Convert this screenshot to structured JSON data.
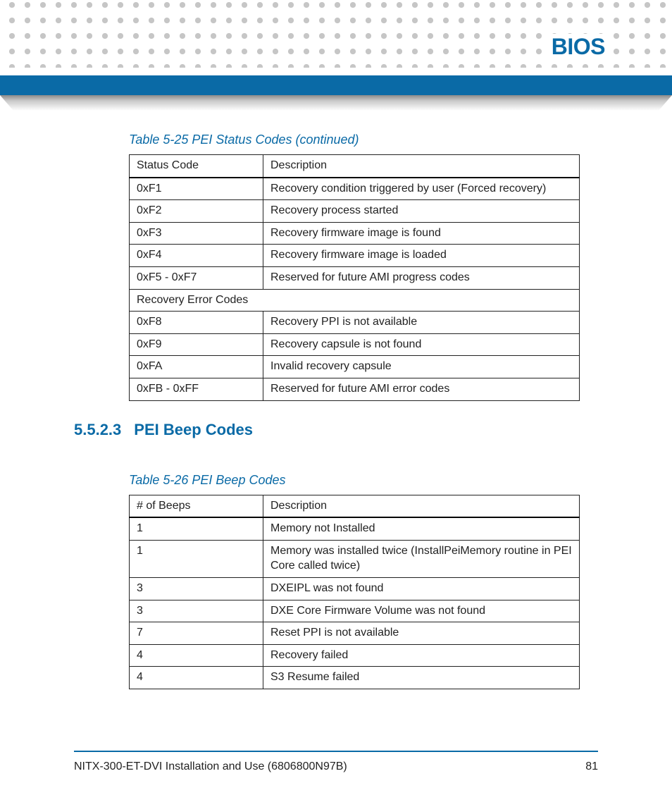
{
  "header": {
    "title": "BIOS"
  },
  "table_25": {
    "caption": "Table 5-25 PEI Status Codes (continued)",
    "headers": {
      "c0": "Status Code",
      "c1": "Description"
    },
    "rows": [
      {
        "c0": "0xF1",
        "c1": "Recovery condition triggered by user (Forced recovery)"
      },
      {
        "c0": "0xF2",
        "c1": "Recovery process started"
      },
      {
        "c0": "0xF3",
        "c1": "Recovery firmware image is found"
      },
      {
        "c0": "0xF4",
        "c1": "Recovery firmware image is loaded"
      },
      {
        "c0": "0xF5 - 0xF7",
        "c1": "Reserved for future AMI progress codes"
      }
    ],
    "span_row": "Recovery Error Codes",
    "rows2": [
      {
        "c0": "0xF8",
        "c1": "Recovery PPI is not available"
      },
      {
        "c0": "0xF9",
        "c1": "Recovery capsule is not found"
      },
      {
        "c0": "0xFA",
        "c1": "Invalid recovery capsule"
      },
      {
        "c0": "0xFB - 0xFF",
        "c1": "Reserved for future AMI error codes"
      }
    ]
  },
  "section": {
    "num": "5.5.2.3",
    "title": "PEI Beep Codes"
  },
  "table_26": {
    "caption": "Table 5-26 PEI Beep Codes",
    "headers": {
      "c0": "# of Beeps",
      "c1": "Description"
    },
    "rows": [
      {
        "c0": "1",
        "c1": "Memory not Installed"
      },
      {
        "c0": "1",
        "c1": "Memory was installed twice (InstallPeiMemory routine in PEI Core called twice)"
      },
      {
        "c0": "3",
        "c1": "DXEIPL was not found"
      },
      {
        "c0": "3",
        "c1": "DXE Core Firmware Volume was not found"
      },
      {
        "c0": "7",
        "c1": "Reset PPI is not available"
      },
      {
        "c0": "4",
        "c1": "Recovery failed"
      },
      {
        "c0": "4",
        "c1": "S3 Resume failed"
      }
    ]
  },
  "footer": {
    "doc": "NITX-300-ET-DVI Installation and Use (6806800N97B)",
    "page": "81"
  }
}
